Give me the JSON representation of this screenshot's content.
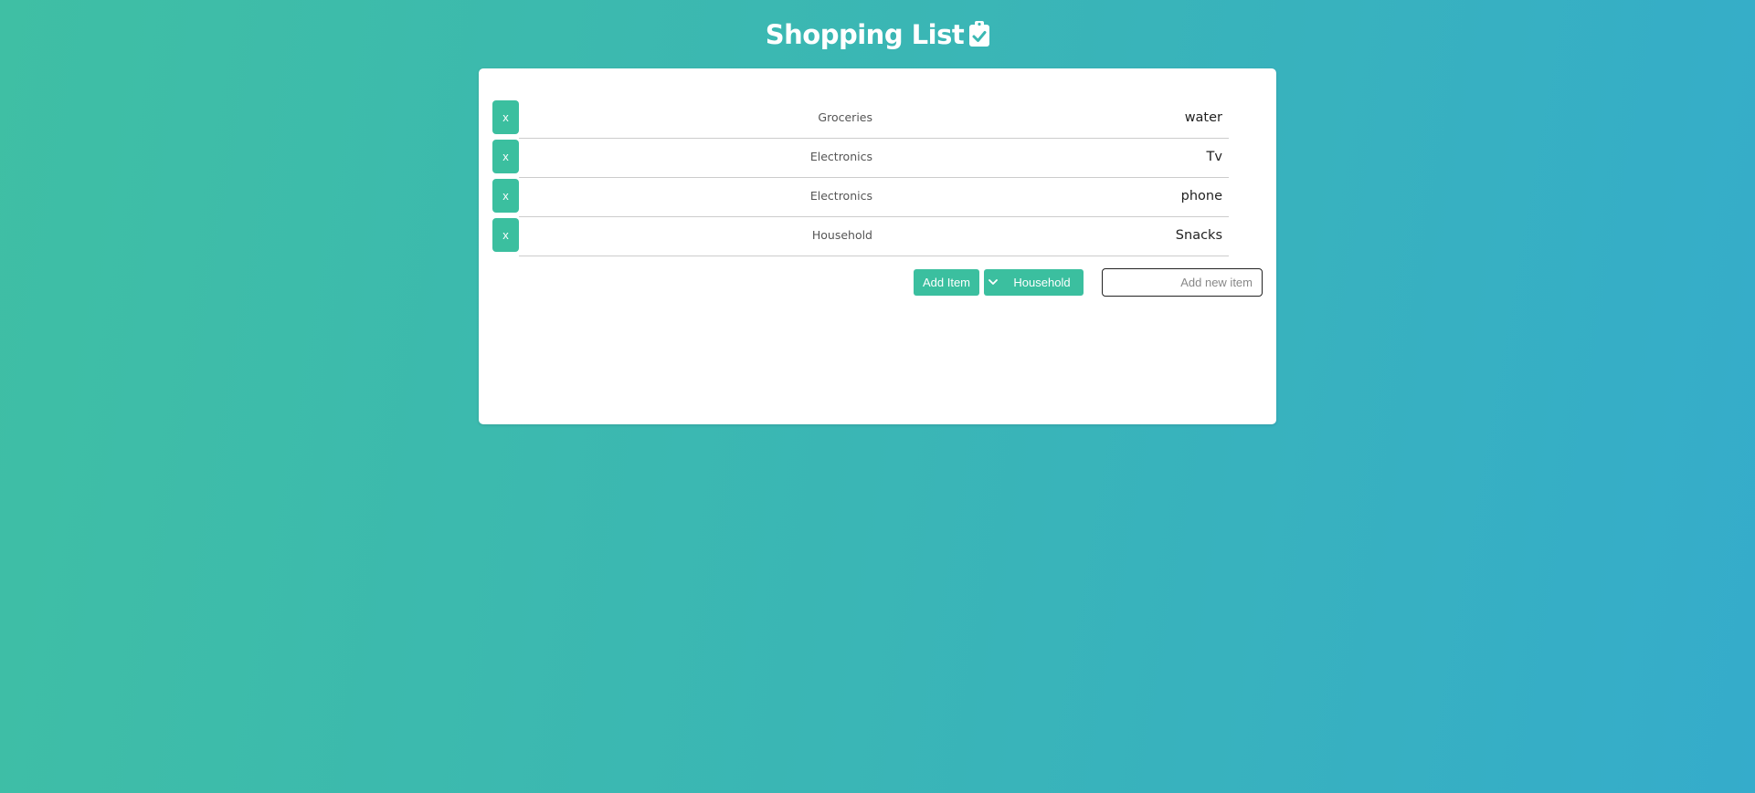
{
  "header": {
    "title": "Shopping List"
  },
  "items": [
    {
      "delete_label": "x",
      "category": "Groceries",
      "name": "water"
    },
    {
      "delete_label": "x",
      "category": "Electronics",
      "name": "Tv"
    },
    {
      "delete_label": "x",
      "category": "Electronics",
      "name": "phone"
    },
    {
      "delete_label": "x",
      "category": "Household",
      "name": "Snacks"
    }
  ],
  "form": {
    "add_label": "Add Item",
    "category_selected": "Household",
    "input_value": "",
    "input_placeholder": "Add new item"
  },
  "colors": {
    "accent": "#3bbf9f",
    "background_start": "#3fbfa4",
    "background_end": "#35accb"
  },
  "icons": {
    "title_icon": "clipboard-check-icon",
    "select_icon": "chevron-down-icon"
  }
}
